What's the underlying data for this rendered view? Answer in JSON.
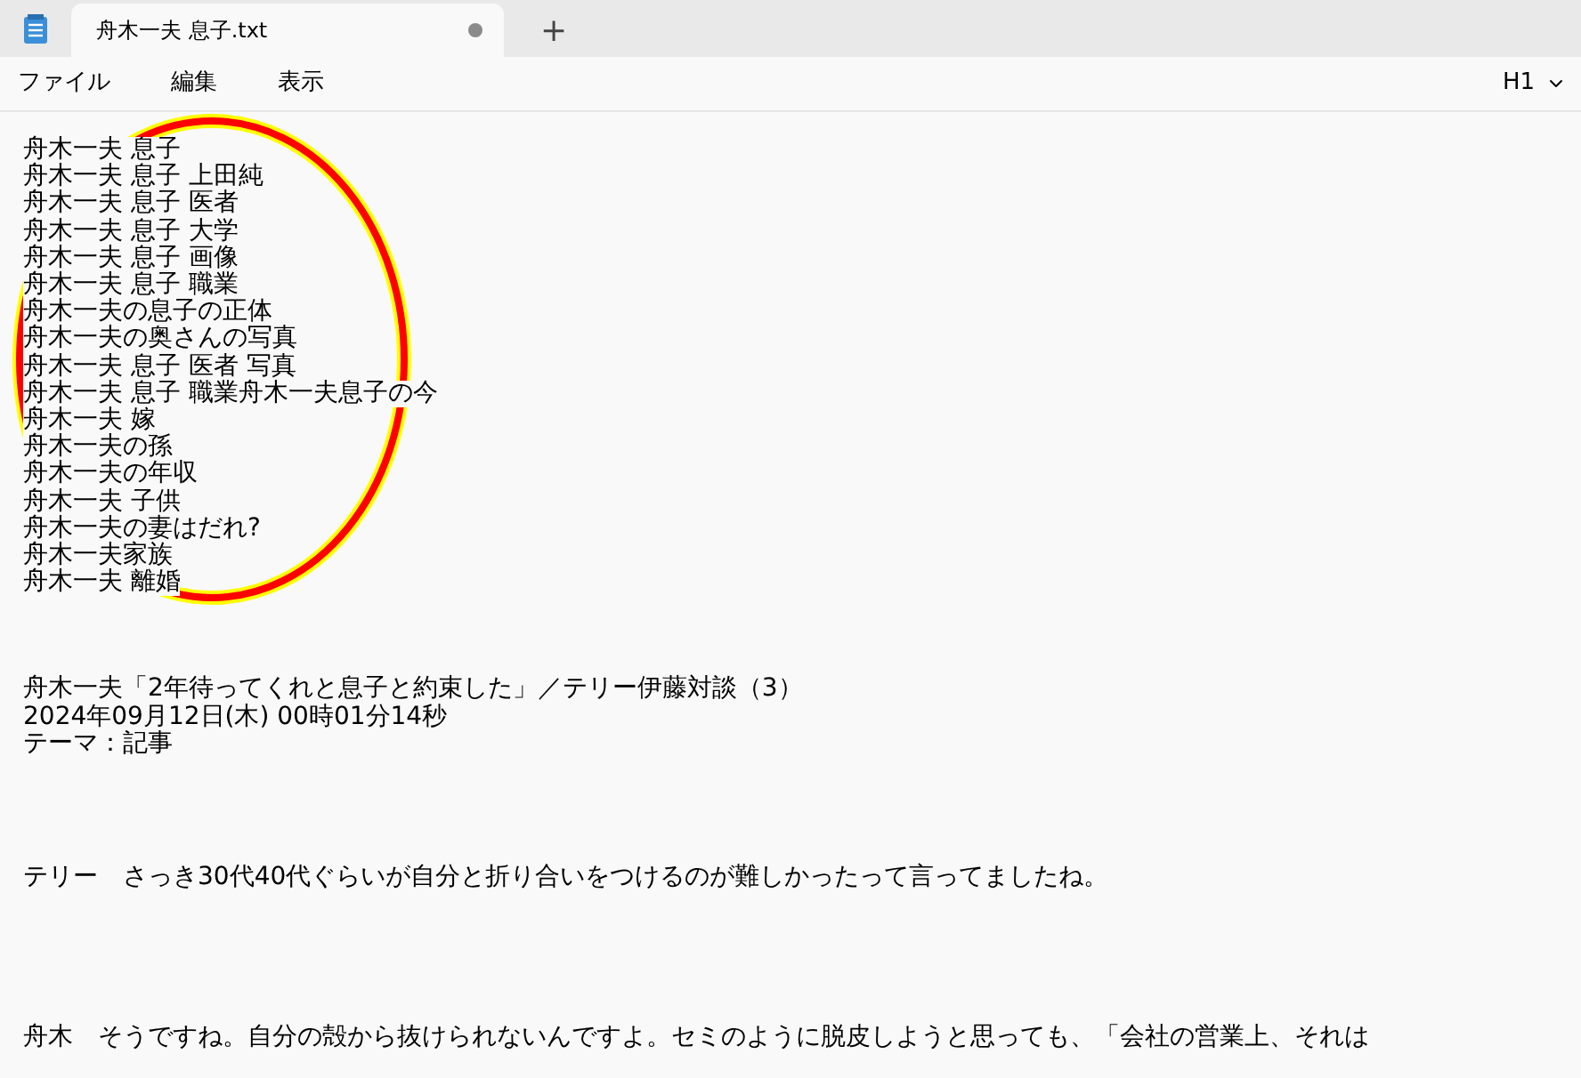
{
  "tabs": [
    {
      "label": "舟木一夫 息子.txt",
      "selected": true,
      "modified": true
    }
  ],
  "new_tab": "+",
  "menu": [
    "ファイル",
    "編集",
    "表示"
  ],
  "format_dropdown": {
    "value": "H1"
  },
  "document": {
    "blocks": [
      {
        "lines": [
          "舟木一夫 息子",
          "舟木一夫 息子 上田純",
          "舟木一夫 息子 医者",
          "舟木一夫 息子 大学",
          "舟木一夫 息子 画像",
          "舟木一夫 息子 職業",
          "舟木一夫の息子の正体",
          "舟木一夫の奥さんの写真",
          "舟木一夫 息子 医者 写真",
          "舟木一夫 息子 職業舟木一夫息子の今",
          "舟木一夫 嫁",
          "舟木一夫の孫",
          "舟木一夫の年収",
          "舟木一夫 子供",
          "舟木一夫の妻はだれ?",
          "舟木一夫家族",
          "舟木一夫 離婚"
        ]
      },
      {
        "lines": [
          "舟木一夫「2年待ってくれと息子と約束した」／テリー伊藤対談（3）",
          "2024年09月12日(木) 00時01分14秒",
          "テーマ：記事"
        ]
      },
      {
        "lines": [
          "テリー　さっき30代40代ぐらいが自分と折り合いをつけるのが難しかったって言ってましたね。"
        ]
      },
      {
        "lines": [
          "舟木　そうですね。自分の殻から抜けられないんですよ。セミのように脱皮しようと思っても、「会社の営業上、それは"
        ]
      }
    ]
  }
}
